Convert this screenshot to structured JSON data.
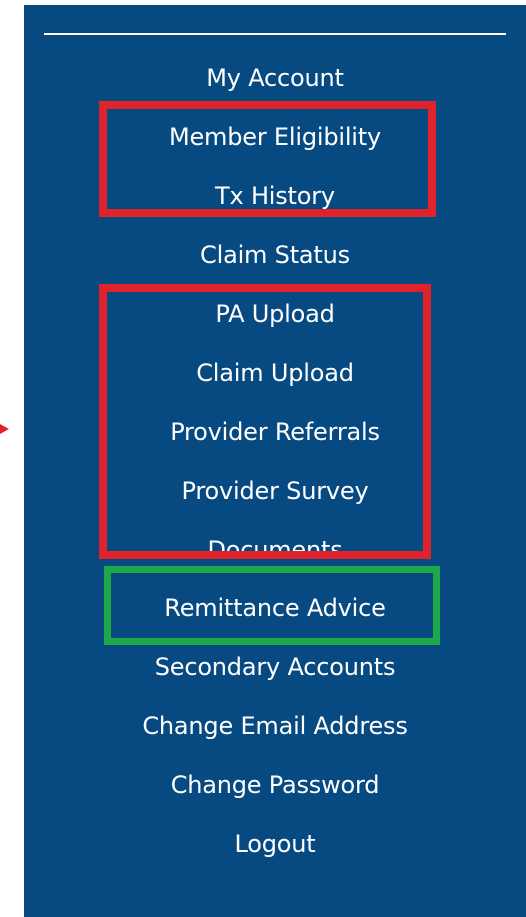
{
  "menu": {
    "items": [
      {
        "label": "My Account"
      },
      {
        "label": "Member Eligibility"
      },
      {
        "label": "Tx History"
      },
      {
        "label": "Claim Status"
      },
      {
        "label": "PA Upload"
      },
      {
        "label": "Claim Upload"
      },
      {
        "label": "Provider Referrals"
      },
      {
        "label": "Provider Survey"
      },
      {
        "label": "Documents"
      },
      {
        "label": "Remittance Advice"
      },
      {
        "label": "Secondary Accounts"
      },
      {
        "label": "Change Email Address"
      },
      {
        "label": "Change Password"
      },
      {
        "label": "Logout"
      }
    ]
  },
  "annotations": {
    "red_color": "#e0222b",
    "green_color": "#1ea84a"
  },
  "colors": {
    "panel_background": "#074a82",
    "text": "#ffffff"
  }
}
